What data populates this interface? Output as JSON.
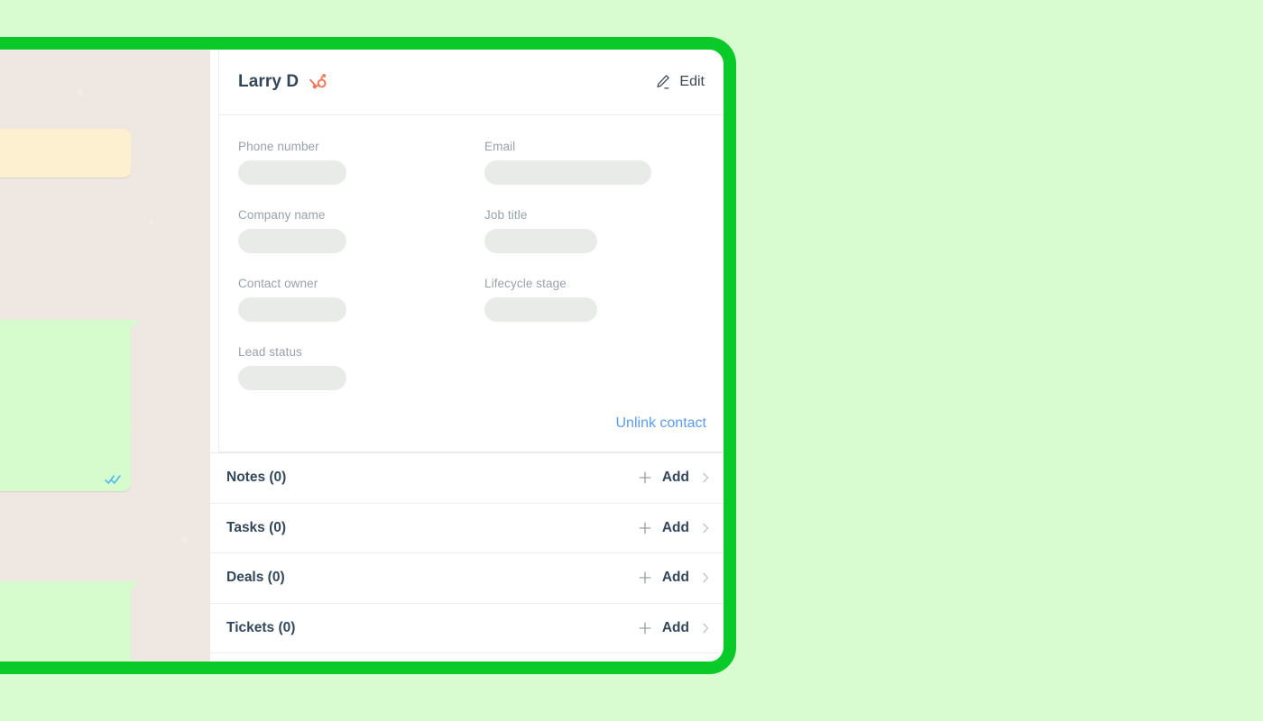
{
  "theme": {
    "page_background": "#d8fbcf",
    "highlight_frame": "#09ca28",
    "chat_background": "#efe7e1",
    "outgoing_bubble": "#d6fbcc",
    "system_bubble": "#fdf0d1",
    "panel_background": "#ffffff",
    "brand_orange": "#f2785c",
    "link_blue": "#5b9bf3",
    "heading_color": "#33475b",
    "label_gray": "#9aa1a9",
    "skeleton_gray": "#e9ebe9",
    "tick_blue": "#53bdeb"
  },
  "panel": {
    "header": {
      "contact_name": "Larry D",
      "crm_logo": "hubspot-sprocket-icon",
      "edit_label": "Edit",
      "edit_icon": "pencil-icon"
    },
    "properties": [
      {
        "label": "Phone number",
        "value": "",
        "skeleton_width": "sk-w-120"
      },
      {
        "label": "Email",
        "value": "",
        "skeleton_width": "sk-w-185"
      },
      {
        "label": "Company name",
        "value": "",
        "skeleton_width": "sk-w-120"
      },
      {
        "label": "Job title",
        "value": "",
        "skeleton_width": "sk-w-125"
      },
      {
        "label": "Contact owner",
        "value": "",
        "skeleton_width": "sk-w-120"
      },
      {
        "label": "Lifecycle stage",
        "value": "",
        "skeleton_width": "sk-w-125"
      },
      {
        "label": "Lead status",
        "value": "",
        "skeleton_width": "sk-w-120"
      }
    ],
    "unlink_label": "Unlink contact",
    "associations": [
      {
        "title": "Notes (0)",
        "count": 0,
        "add_label": "Add",
        "expand_icon": "chevron-right-icon"
      },
      {
        "title": "Tasks (0)",
        "count": 0,
        "add_label": "Add",
        "expand_icon": "chevron-right-icon"
      },
      {
        "title": "Deals (0)",
        "count": 0,
        "add_label": "Add",
        "expand_icon": "chevron-right-icon"
      },
      {
        "title": "Tickets (0)",
        "count": 0,
        "add_label": "Add",
        "expand_icon": "chevron-right-icon"
      }
    ]
  },
  "chat": {
    "bubbles": [
      {
        "type": "system",
        "text": "",
        "receipt": ""
      },
      {
        "type": "outgoing",
        "text": "",
        "receipt": "read-double-check-icon"
      },
      {
        "type": "outgoing",
        "text": "",
        "receipt": "read-double-check-icon"
      }
    ]
  }
}
